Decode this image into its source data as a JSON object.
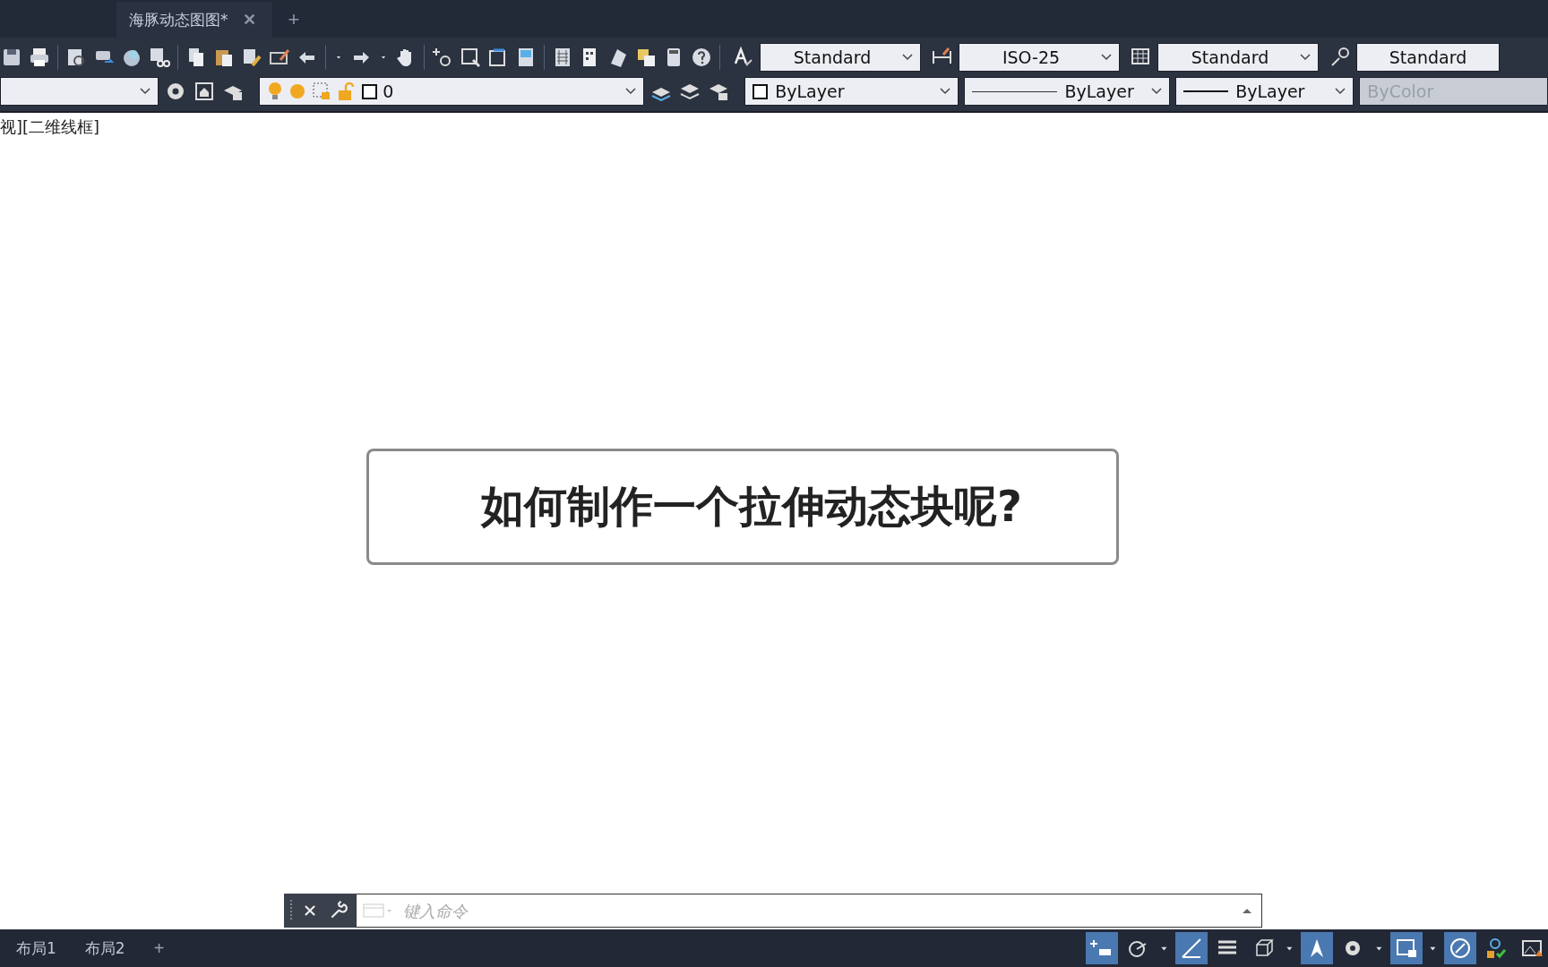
{
  "document_tabs": [
    {
      "label": "海豚动态图图*",
      "selected": true
    }
  ],
  "tab_close": "✕",
  "tab_add": "+",
  "style_dropdowns": [
    {
      "value": "Standard"
    },
    {
      "value": "ISO-25"
    },
    {
      "value": "Standard"
    },
    {
      "value": "Standard"
    }
  ],
  "layer": {
    "value": "0"
  },
  "properties": [
    {
      "kind": "color",
      "value": "ByLayer",
      "disabled": false
    },
    {
      "kind": "linetype",
      "value": "ByLayer",
      "disabled": false
    },
    {
      "kind": "lineweight",
      "value": "ByLayer",
      "disabled": false
    },
    {
      "kind": "plotstyle",
      "value": "ByColor",
      "disabled": true
    }
  ],
  "viewport_label": "视][二维线框]",
  "callout": "如何制作一个拉伸动态块呢?",
  "command_line": {
    "placeholder": "键入命令"
  },
  "layout_tabs": [
    {
      "label": "布局1"
    },
    {
      "label": "布局2"
    }
  ],
  "layout_add": "+",
  "status_toggles": [
    {
      "on": true
    },
    {
      "on": false
    },
    {
      "on": true
    },
    {
      "on": false
    },
    {
      "on": false
    },
    {
      "on": true
    },
    {
      "on": false
    },
    {
      "on": true
    },
    {
      "on": true
    },
    {
      "on": false
    },
    {
      "on": false
    }
  ]
}
